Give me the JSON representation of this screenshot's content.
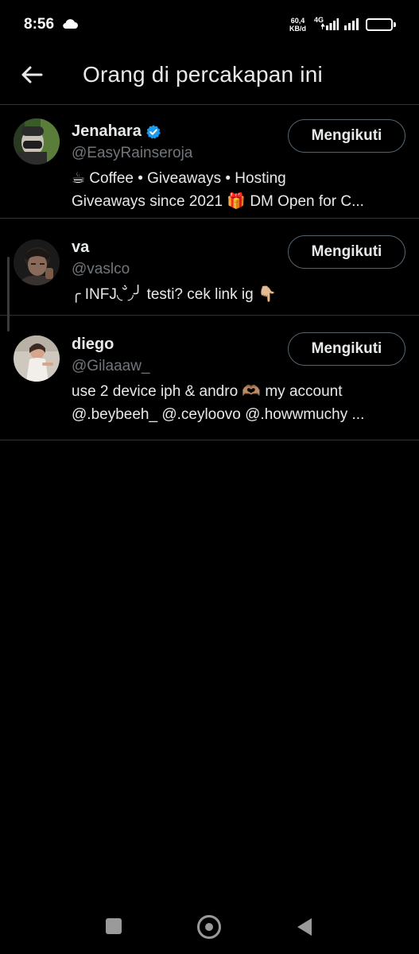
{
  "status_bar": {
    "time": "8:56",
    "net_speed_value": "60,4",
    "net_speed_unit": "KB/d",
    "network_type": "4G",
    "battery": "94",
    "battery_level": 0.94
  },
  "header": {
    "title": "Orang di percakapan ini"
  },
  "users": [
    {
      "name": "Jenahara",
      "verified": true,
      "handle": "@EasyRainseroja",
      "bio_line1": "☕ Coffee • Giveaways • Hosting",
      "bio_line2": "Giveaways since 2021 🎁 DM Open for C...",
      "follow_label": "Mengikuti"
    },
    {
      "name": "va",
      "verified": false,
      "handle": "@vaslco",
      "bio_line1": "╭ INFJ◟˘̀◞╯ testi? cek link ig 👇🏼",
      "follow_label": "Mengikuti"
    },
    {
      "name": "diego",
      "verified": false,
      "handle": "@Gilaaaw_",
      "bio_line1": "use 2 device iph & andro 🫶🏽 my account",
      "bio_line2": "@.beybeeh_ @.ceyloovo @.howwmuchy ...",
      "follow_label": "Mengikuti"
    }
  ],
  "colors": {
    "background": "#000000",
    "text_primary": "#e7e9ea",
    "text_secondary": "#71767b",
    "divider": "#2f3336",
    "verified_badge": "#1d9bf0"
  }
}
